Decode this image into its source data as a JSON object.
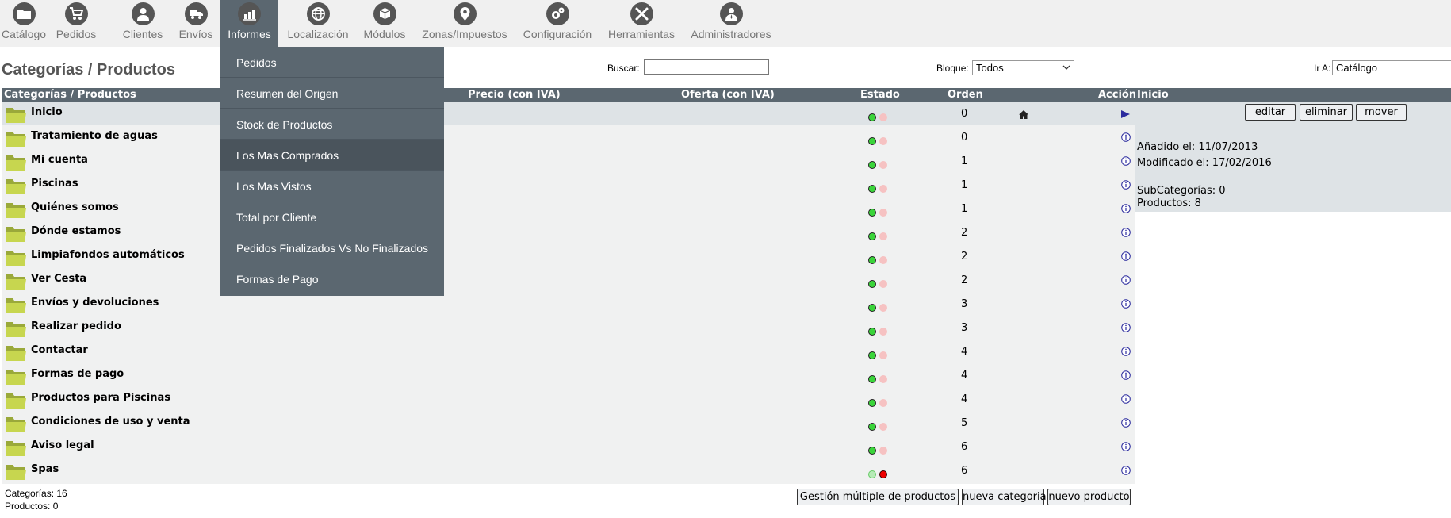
{
  "nav": {
    "items": [
      {
        "label": "Catálogo",
        "icon": "folder-icon"
      },
      {
        "label": "Pedidos",
        "icon": "cart-icon"
      },
      {
        "label": "Clientes",
        "icon": "user-icon"
      },
      {
        "label": "Envíos",
        "icon": "truck-icon"
      },
      {
        "label": "Informes",
        "icon": "chart-icon"
      },
      {
        "label": "Localización",
        "icon": "globe-icon"
      },
      {
        "label": "Módulos",
        "icon": "puzzle-icon"
      },
      {
        "label": "Zonas/Impuestos",
        "icon": "pin-icon"
      },
      {
        "label": "Configuración",
        "icon": "gears-icon"
      },
      {
        "label": "Herramientas",
        "icon": "tools-icon"
      },
      {
        "label": "Administradores",
        "icon": "admin-icon"
      }
    ],
    "active": "Informes"
  },
  "dropdown": {
    "items": [
      "Pedidos",
      "Resumen del Origen",
      "Stock de Productos",
      "Los Mas Comprados",
      "Los Mas Vistos",
      "Total por Cliente",
      "Pedidos Finalizados Vs No Finalizados",
      "Formas de Pago"
    ],
    "highlighted": "Los Mas Comprados"
  },
  "page": {
    "title": "Categorías / Productos",
    "search_label": "Buscar:",
    "search_value": "",
    "bloque_label": "Bloque:",
    "bloque_value": "Todos",
    "ira_label": "Ir A:",
    "ira_value": "Catálogo"
  },
  "table": {
    "headers": {
      "name": "Categorías / Productos",
      "price": "Precio (con IVA)",
      "offer": "Oferta (con IVA)",
      "status": "Estado",
      "order": "Orden",
      "action": "Acción"
    },
    "rows": [
      {
        "name": "Inicio",
        "order": "0",
        "status_active": true
      },
      {
        "name": "Tratamiento de aguas",
        "order": "0",
        "status_active": true
      },
      {
        "name": "Mi cuenta",
        "order": "1",
        "status_active": true
      },
      {
        "name": "Piscinas",
        "order": "1",
        "status_active": true
      },
      {
        "name": "Quiénes somos",
        "order": "1",
        "status_active": true
      },
      {
        "name": "Dónde estamos",
        "order": "2",
        "status_active": true
      },
      {
        "name": "Limpiafondos automáticos",
        "order": "2",
        "status_active": true
      },
      {
        "name": "Ver Cesta",
        "order": "2",
        "status_active": true
      },
      {
        "name": "Envíos y devoluciones",
        "order": "3",
        "status_active": true
      },
      {
        "name": "Realizar pedido",
        "order": "3",
        "status_active": true
      },
      {
        "name": "Contactar",
        "order": "4",
        "status_active": true
      },
      {
        "name": "Formas de pago",
        "order": "4",
        "status_active": true
      },
      {
        "name": "Productos para Piscinas",
        "order": "4",
        "status_active": true
      },
      {
        "name": "Condiciones de uso y venta",
        "order": "5",
        "status_active": true
      },
      {
        "name": "Aviso legal",
        "order": "6",
        "status_active": true
      },
      {
        "name": "Spas",
        "order": "6",
        "status_active": false
      }
    ],
    "selected_row": "Inicio"
  },
  "panel": {
    "title": "Inicio",
    "edit_label": "editar",
    "delete_label": "eliminar",
    "move_label": "mover",
    "added": "Añadido el: 11/07/2013",
    "modified": "Modificado el: 17/02/2016",
    "subcategories": "SubCategorías: 0",
    "products": "Productos: 8"
  },
  "footer": {
    "categories": "Categorías: 16",
    "products": "Productos: 0",
    "bulk_label": "Gestión múltiple de productos",
    "new_category_label": "nueva categoria",
    "new_product_label": "nuevo producto"
  },
  "colors": {
    "nav_active": "#5b6770",
    "table_header": "#5b6770",
    "row_bg": "#f0f1f1",
    "selected_bg": "#dee3e6",
    "status_green": "#3ad43a",
    "status_red": "#ee0000"
  }
}
